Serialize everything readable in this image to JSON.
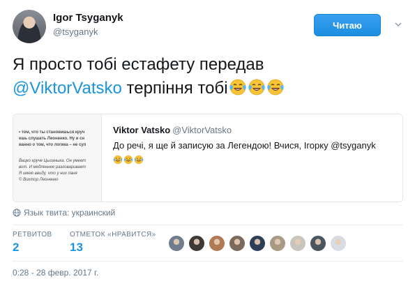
{
  "author": {
    "name": "Igor Tsyganyk",
    "handle": "@tsyganyk"
  },
  "follow_button": {
    "label": "Читаю"
  },
  "tweet": {
    "text_line1": "Я просто тобі естафету передав",
    "mention": "@ViktorVatsko",
    "text_line2_rest": " терпіння тобі",
    "emoji": "face-with-tears-of-joy",
    "emoji_count": 3
  },
  "quote": {
    "name": "Viktor Vatsko",
    "handle": "@ViktorVatsko",
    "text": "До речі, я ще й записую за Легендою! Вчися, Ігорку @tsyganyk",
    "image_lines": [
      "• том, что ты становишься круч",
      "ешь слушать Леоненко. Ну и сн",
      "ванно о том, что логика – не суп"
    ],
    "image_lines_2": [
      "Вацко круче Цыганыка. Он умеет",
      "вот. И медленнее разговаривает",
      "Я имею ввиду, что у них паня",
      "© Виктор Леоненко"
    ]
  },
  "language": {
    "label": "Язык твита: украинский",
    "icon": "globe-icon"
  },
  "stats": {
    "retweets_label": "РЕТВИТОВ",
    "retweets_value": "2",
    "likes_label": "ОТМЕТОК «НРАВИТСЯ»",
    "likes_value": "13"
  },
  "likers": {
    "count": 9,
    "colors": [
      "#6f7d8c",
      "#3e3a36",
      "#b07a55",
      "#7b6a5c",
      "#2d3e57",
      "#a89a85",
      "#c9c4bd",
      "#4a5560",
      "#d9dde3"
    ]
  },
  "timestamp": "0:28 - 28 февр. 2017 г.",
  "colors": {
    "accent": "#1b95e0",
    "follow_bg": "#1b8ee0",
    "muted": "#657786"
  }
}
